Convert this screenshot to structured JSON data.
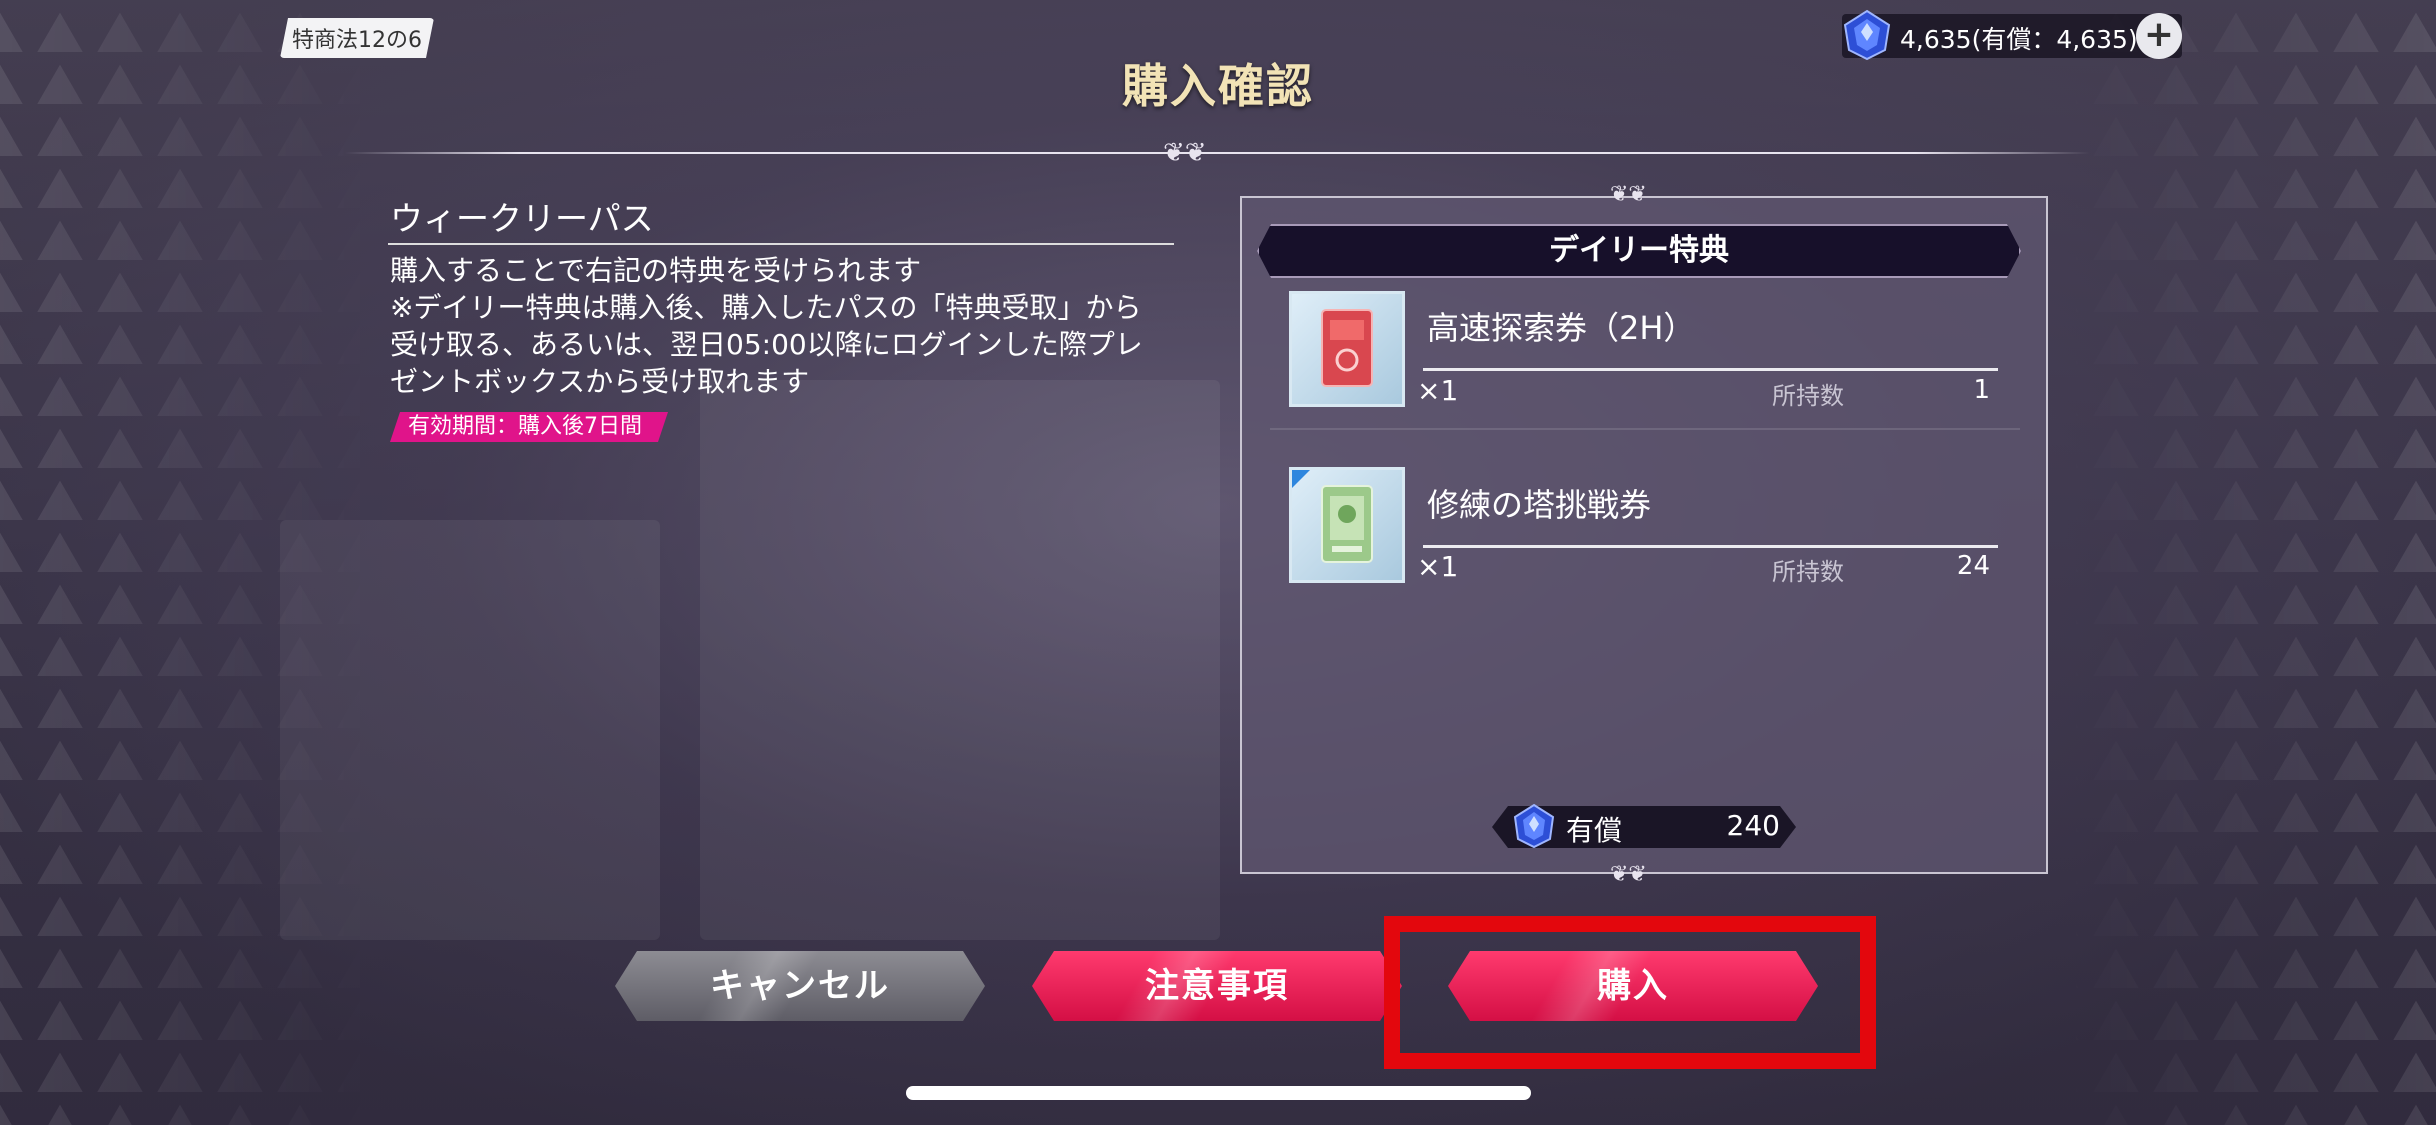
{
  "header": {
    "law_tag": "特商法12の6",
    "title": "購入確認",
    "currency_text": "4,635(有償：4,635)",
    "plus_label": "+"
  },
  "pass": {
    "name": "ウィークリーパス",
    "description_lines": [
      "購入することで右記の特典を受けられます",
      "※デイリー特典は購入後、購入したパスの「特典受取」から",
      "受け取る、あるいは、翌日05:00以降にログインした際プレ",
      "ゼントボックスから受け取れます"
    ],
    "validity": "有効期間：購入後7日間"
  },
  "rewards": {
    "header": "デイリー特典",
    "items": [
      {
        "name": "高速探索券（2H）",
        "qty": "×1",
        "owned_label": "所持数",
        "owned": "1",
        "icon": "red-ticket-icon"
      },
      {
        "name": "修練の塔挑戦券",
        "qty": "×1",
        "owned_label": "所持数",
        "owned": "24",
        "icon": "green-ticket-icon"
      }
    ]
  },
  "price": {
    "label": "有償",
    "value": "240"
  },
  "buttons": {
    "cancel": "キャンセル",
    "notes": "注意事項",
    "buy": "購入"
  },
  "colors": {
    "accent_pink": "#e0148a",
    "button_red": "#e8164f",
    "highlight_red": "#e3070d",
    "title_gold": "#f2e3b6"
  }
}
